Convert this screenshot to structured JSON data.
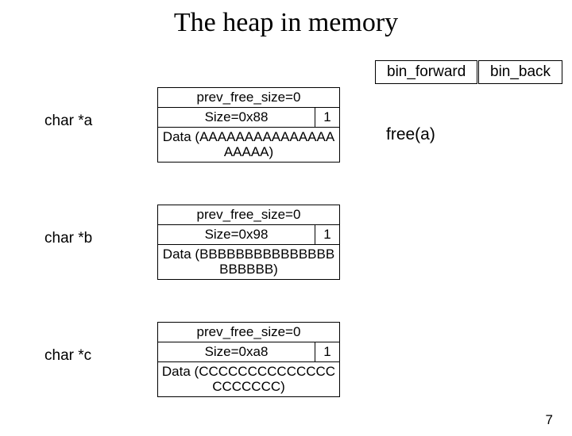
{
  "title": "The heap in memory",
  "bins": {
    "forward": "bin_forward",
    "back": "bin_back"
  },
  "pointers": {
    "a": "char *a",
    "b": "char *b",
    "c": "char *c"
  },
  "blocks": {
    "a": {
      "prev": "prev_free_size=0",
      "size": "Size=0x88",
      "flag": "1",
      "data": "Data (AAAAAAAAAAAAAAAAAAAA)"
    },
    "b": {
      "prev": "prev_free_size=0",
      "size": "Size=0x98",
      "flag": "1",
      "data": "Data (BBBBBBBBBBBBBBBBBBBBB)"
    },
    "c": {
      "prev": "prev_free_size=0",
      "size": "Size=0xa8",
      "flag": "1",
      "data": "Data (CCCCCCCCCCCCCCCCCCCCC)"
    }
  },
  "action": "free(a)",
  "page": "7"
}
